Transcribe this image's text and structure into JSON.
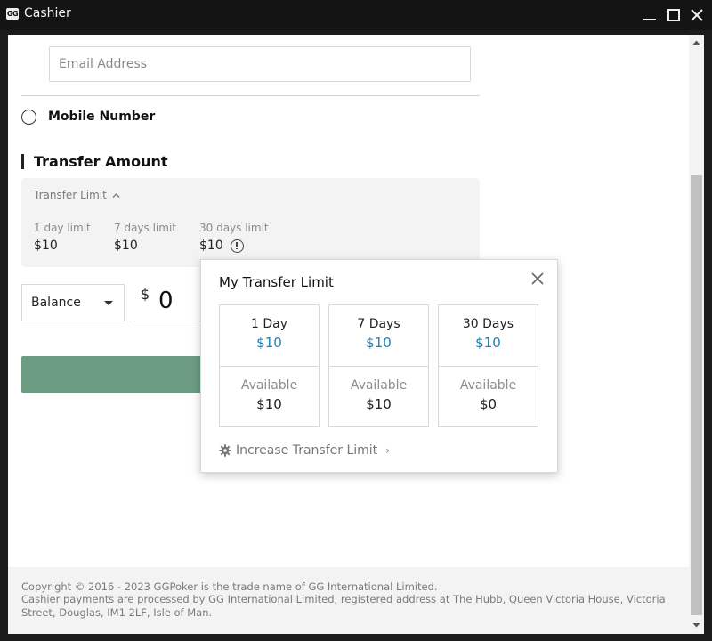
{
  "window": {
    "logo_text": "GG",
    "title": "Cashier"
  },
  "form": {
    "email_placeholder": "Email Address",
    "mobile_label": "Mobile Number",
    "section_title": "Transfer Amount"
  },
  "transfer_limit": {
    "toggle_label": "Transfer Limit",
    "limits": [
      {
        "label": "1 day limit",
        "value": "$10"
      },
      {
        "label": "7 days limit",
        "value": "$10"
      },
      {
        "label": "30 days limit",
        "value": "$10"
      }
    ]
  },
  "amount": {
    "balance_option": "Balance",
    "currency": "$",
    "value": "0"
  },
  "popover": {
    "title": "My Transfer Limit",
    "cards": [
      {
        "period": "1 Day",
        "limit": "$10",
        "available_label": "Available",
        "available": "$10"
      },
      {
        "period": "7 Days",
        "limit": "$10",
        "available_label": "Available",
        "available": "$10"
      },
      {
        "period": "30 Days",
        "limit": "$10",
        "available_label": "Available",
        "available": "$0"
      }
    ],
    "increase_label": "Increase Transfer Limit"
  },
  "footer": {
    "copyright": "Copyright © 2016 - 2023 GGPoker is the trade name of GG International Limited.",
    "processor": "Cashier payments are processed by GG International Limited, registered address at The Hubb, Queen Victoria House, Victoria Street, Douglas, IM1 2LF, Isle of Man."
  },
  "colors": {
    "accent_blue": "#1e82b4",
    "button_green": "#6b9c82"
  }
}
